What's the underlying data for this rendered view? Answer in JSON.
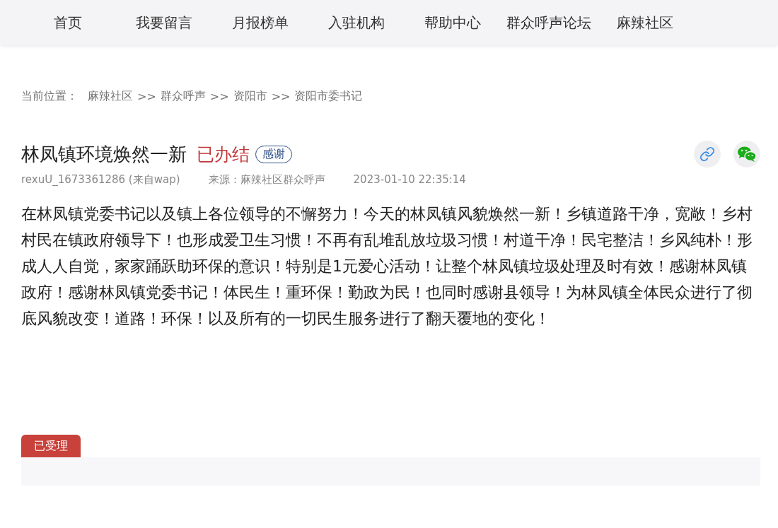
{
  "nav": [
    {
      "label": "首页"
    },
    {
      "label": "我要留言"
    },
    {
      "label": "月报榜单"
    },
    {
      "label": "入驻机构"
    },
    {
      "label": "帮助中心"
    },
    {
      "label": "群众呼声论坛"
    },
    {
      "label": "麻辣社区"
    }
  ],
  "breadcrumb": {
    "label": "当前位置：",
    "items": [
      "麻辣社区",
      ">>",
      "群众呼声",
      ">>",
      "资阳市",
      ">>",
      "资阳市委书记"
    ]
  },
  "post": {
    "title": "林凤镇环境焕然一新",
    "status": "已办结",
    "tag": "感谢",
    "author": "rexuU_1673361286 (来自wap)",
    "source": "来源：麻辣社区群众呼声",
    "time": "2023-01-10 22:35:14",
    "body": "在林凤镇党委书记以及镇上各位领导的不懈努力！今天的林凤镇风貌焕然一新！乡镇道路干净，宽敞！乡村村民在镇政府领导下！也形成爱卫生习惯！不再有乱堆乱放垃圾习惯！村道干净！民宅整洁！乡风纯朴！形成人人自觉，家家踊跃助环保的意识！特别是1元爱心活动！让整个林凤镇垃圾处理及时有效！感谢林凤镇政府！感谢林凤镇党委书记！体民生！重环保！勤政为民！也同时感谢县领导！为林凤镇全体民众进行了彻底风貌改变！道路！环保！以及所有的一切民生服务进行了翻天覆地的变化！"
  },
  "reply": {
    "label": "已受理"
  }
}
